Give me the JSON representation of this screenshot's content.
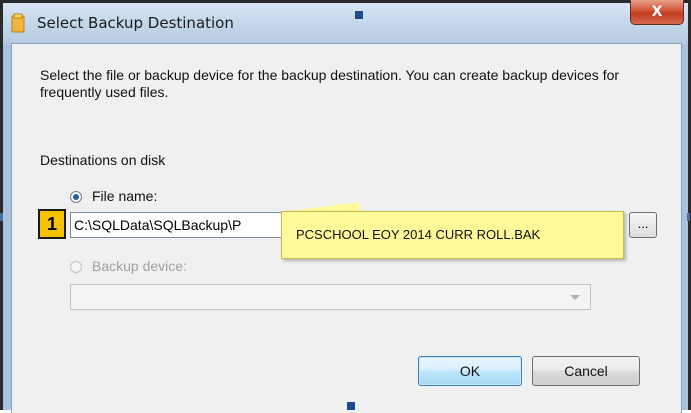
{
  "window": {
    "title": "Select Backup Destination",
    "close_glyph": "X"
  },
  "instructions": "Select the file or backup device for the backup destination. You can create backup devices for frequently used files.",
  "destinations_label": "Destinations on disk",
  "file_name": {
    "label": "File name:",
    "selected": true,
    "value": "C:\\SQLData\\SQLBackup\\P",
    "browse_label": "..."
  },
  "backup_device": {
    "label": "Backup device:",
    "selected": false,
    "value": ""
  },
  "buttons": {
    "ok": "OK",
    "cancel": "Cancel"
  },
  "annotation": {
    "step": "1",
    "callout_text": "PCSCHOOL EOY 2014 CURR ROLL.BAK"
  },
  "colors": {
    "callout_bg": "#fff99a",
    "step_badge_bg": "#f3c200",
    "radio_selected": "#1e5ea8"
  },
  "icons": {
    "title_icon": "folder-icon",
    "dropdown_icon": "chevron-down-icon"
  }
}
